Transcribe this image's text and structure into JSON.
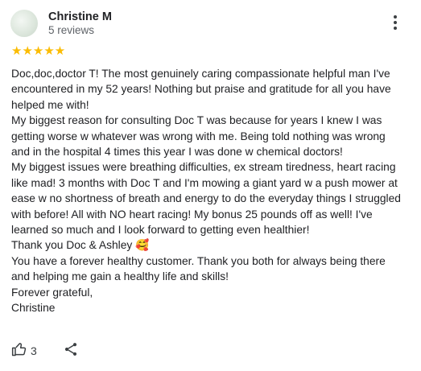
{
  "reviewer": {
    "name": "Christine M",
    "reviews": "5 reviews"
  },
  "rating": {
    "stars": 5,
    "display": "★★★★★",
    "color": "#fbbc04"
  },
  "review_lines": [
    "Doc,doc,doctor T! The most genuinely caring compassionate helpful man I've",
    "encountered in my 52 years! Nothing but praise and gratitude for all you have",
    "helped me with!",
    "My biggest reason for consulting Doc T was because for years I knew I was",
    "getting worse w whatever was wrong with me. Being told nothing was wrong",
    "and in the hospital 4 times this year I was done w chemical doctors!",
    "My biggest issues were breathing difficulties, ex stream tiredness, heart racing",
    "like mad! 3 months with Doc T and I'm mowing a giant yard w a push mower at",
    "ease w no shortness of breath and energy to do the everyday things I struggled",
    "with before! All with NO heart racing! My bonus 25 pounds off as well! I've",
    "learned so much and I look forward to getting even healthier!",
    "Thank you Doc & Ashley 🥰",
    "You have a forever healthy customer. Thank you both for always being there",
    "and helping me gain a healthy life and skills!",
    "Forever grateful,",
    "Christine"
  ],
  "actions": {
    "like_icon": "thumbs-up-icon",
    "like_count": "3",
    "share_icon": "share-icon",
    "more_icon": "more-vert-icon"
  }
}
